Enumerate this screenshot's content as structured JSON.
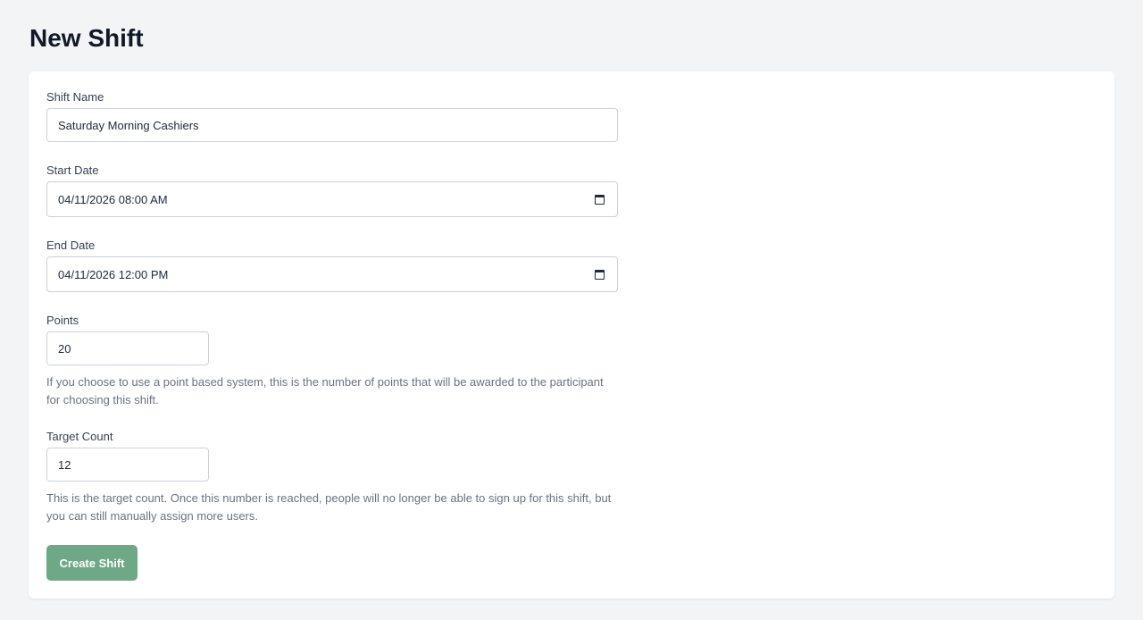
{
  "page": {
    "title": "New Shift"
  },
  "form": {
    "shift_name": {
      "label": "Shift Name",
      "value": "Saturday Morning Cashiers"
    },
    "start_date": {
      "label": "Start Date",
      "value": "04/11/2026 08:00 AM",
      "icon": "calendar-icon"
    },
    "end_date": {
      "label": "End Date",
      "value": "04/11/2026 12:00 PM",
      "icon": "calendar-icon"
    },
    "points": {
      "label": "Points",
      "value": "20",
      "help": "If you choose to use a point based system, this is the number of points that will be awarded to the participant for choosing this shift."
    },
    "target_count": {
      "label": "Target Count",
      "value": "12",
      "help": "This is the target count. Once this number is reached, people will no longer be able to sign up for this shift, but you can still manually assign more users."
    },
    "submit_label": "Create Shift"
  },
  "colors": {
    "background": "#f3f4f6",
    "card": "#ffffff",
    "button": "#6fa886",
    "title": "#111827"
  }
}
